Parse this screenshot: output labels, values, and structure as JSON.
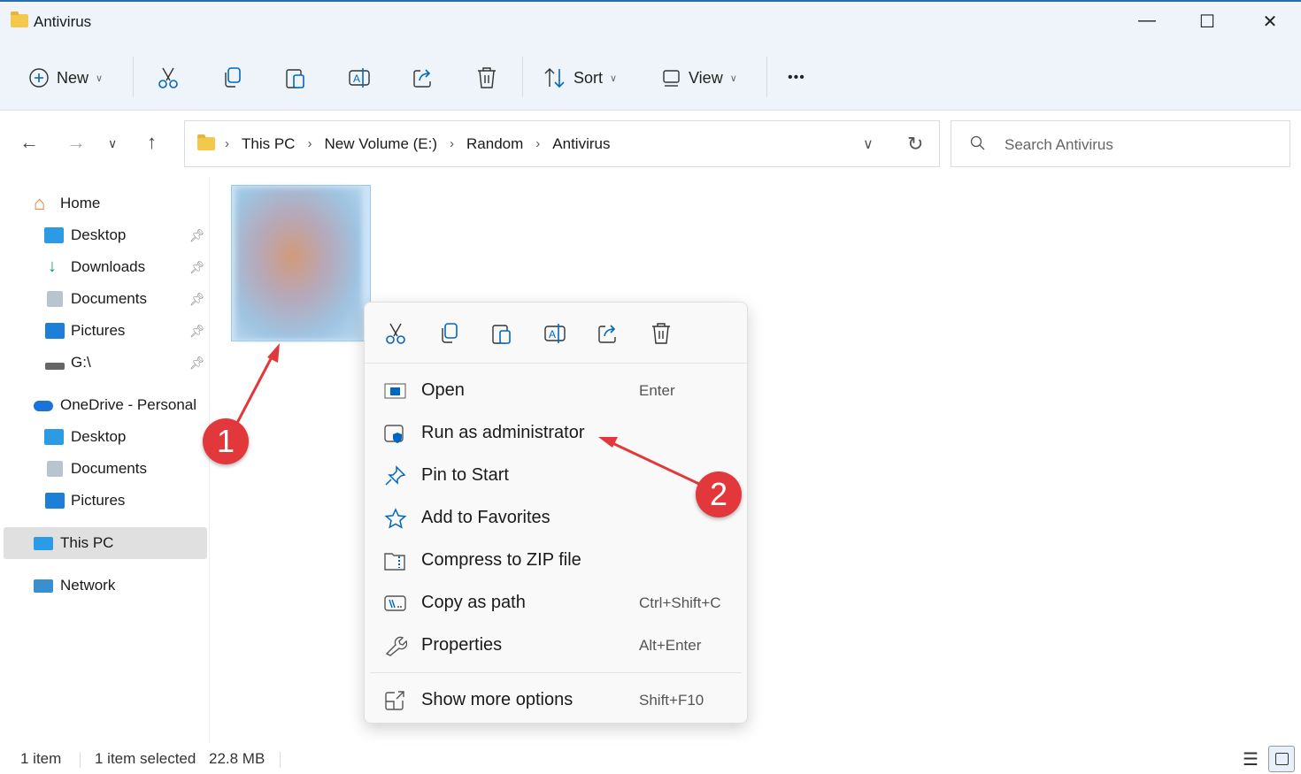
{
  "window": {
    "title": "Antivirus",
    "minimize": "—",
    "maximize": "☐",
    "close": "✕"
  },
  "toolbar": {
    "new": "New",
    "sort": "Sort",
    "view": "View",
    "more": "•••",
    "icons": [
      "cut-icon",
      "copy-icon",
      "paste-icon",
      "rename-icon",
      "share-icon",
      "delete-icon"
    ]
  },
  "address": {
    "crumbs": [
      "This PC",
      "New Volume (E:)",
      "Random",
      "Antivirus"
    ],
    "search_placeholder": "Search Antivirus"
  },
  "sidebar": {
    "items": [
      {
        "label": "Home"
      },
      {
        "label": "Desktop"
      },
      {
        "label": "Downloads"
      },
      {
        "label": "Documents"
      },
      {
        "label": "Pictures"
      },
      {
        "label": "G:\\"
      },
      {
        "label": "OneDrive - Personal"
      },
      {
        "label": "Desktop"
      },
      {
        "label": "Documents"
      },
      {
        "label": "Pictures"
      },
      {
        "label": "This PC"
      },
      {
        "label": "Network"
      }
    ]
  },
  "context_menu": {
    "items": [
      {
        "label": "Open",
        "shortcut": "Enter"
      },
      {
        "label": "Run as administrator",
        "shortcut": ""
      },
      {
        "label": "Pin to Start",
        "shortcut": ""
      },
      {
        "label": "Add to Favorites",
        "shortcut": ""
      },
      {
        "label": "Compress to ZIP file",
        "shortcut": ""
      },
      {
        "label": "Copy as path",
        "shortcut": "Ctrl+Shift+C"
      },
      {
        "label": "Properties",
        "shortcut": "Alt+Enter"
      },
      {
        "label": "Show more options",
        "shortcut": "Shift+F10"
      }
    ]
  },
  "status": {
    "count": "1 item",
    "selected": "1 item selected",
    "size": "22.8 MB"
  },
  "annotations": {
    "one": "1",
    "two": "2"
  },
  "colors": {
    "accent": "#0067c0",
    "annotation": "#e2383c"
  }
}
